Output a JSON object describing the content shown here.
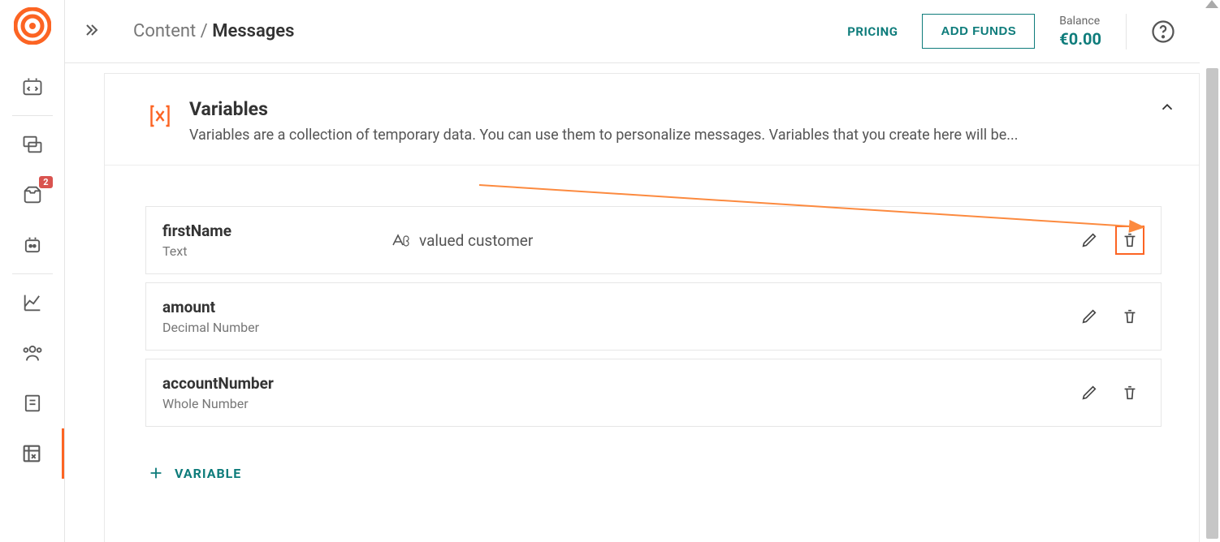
{
  "sidebar": {
    "badge_count": "2"
  },
  "topbar": {
    "breadcrumb_parent": "Content /",
    "breadcrumb_current": "Messages",
    "pricing": "PRICING",
    "add_funds": "ADD FUNDS",
    "balance_label": "Balance",
    "balance_value": "€0.00"
  },
  "section": {
    "title": "Variables",
    "description": "Variables are a collection of temporary data. You can use them to personalize messages. Variables that you create here will be..."
  },
  "variables": [
    {
      "name": "firstName",
      "type": "Text",
      "value": "valued customer",
      "highlight": true
    },
    {
      "name": "amount",
      "type": "Decimal Number",
      "value": "",
      "highlight": false
    },
    {
      "name": "accountNumber",
      "type": "Whole Number",
      "value": "",
      "highlight": false
    }
  ],
  "add_variable_label": "VARIABLE"
}
